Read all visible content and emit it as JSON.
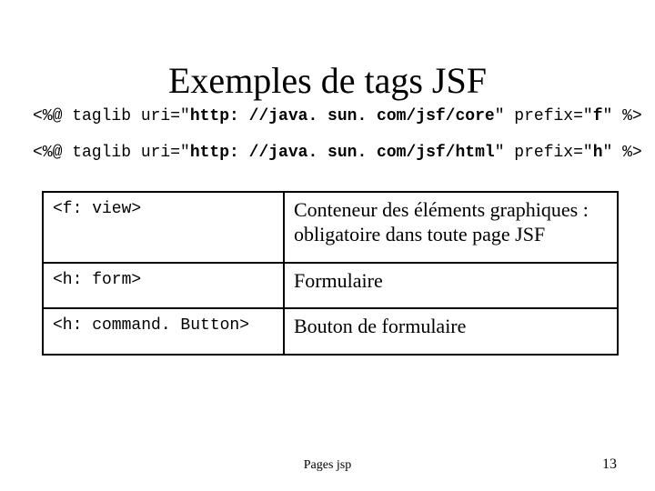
{
  "title": "Exemples de tags JSF",
  "taglib": {
    "line1": {
      "pre": "<%@ taglib uri=\"",
      "uri": "http: //java. sun. com/jsf/core",
      "mid": "\" prefix=\"",
      "prefix": "f",
      "post": "\" %>"
    },
    "line2": {
      "pre": "<%@ taglib uri=\"",
      "uri": "http: //java. sun. com/jsf/html",
      "mid": "\" prefix=\"",
      "prefix": "h",
      "post": "\" %>"
    }
  },
  "table": {
    "rows": [
      {
        "tag": "<f: view>",
        "desc": "Conteneur des éléments graphiques : obligatoire dans toute page JSF"
      },
      {
        "tag": "<h: form>",
        "desc": "Formulaire"
      },
      {
        "tag": "<h: command. Button>",
        "desc": "Bouton de formulaire"
      }
    ]
  },
  "footer": "Pages jsp",
  "page_number": "13"
}
